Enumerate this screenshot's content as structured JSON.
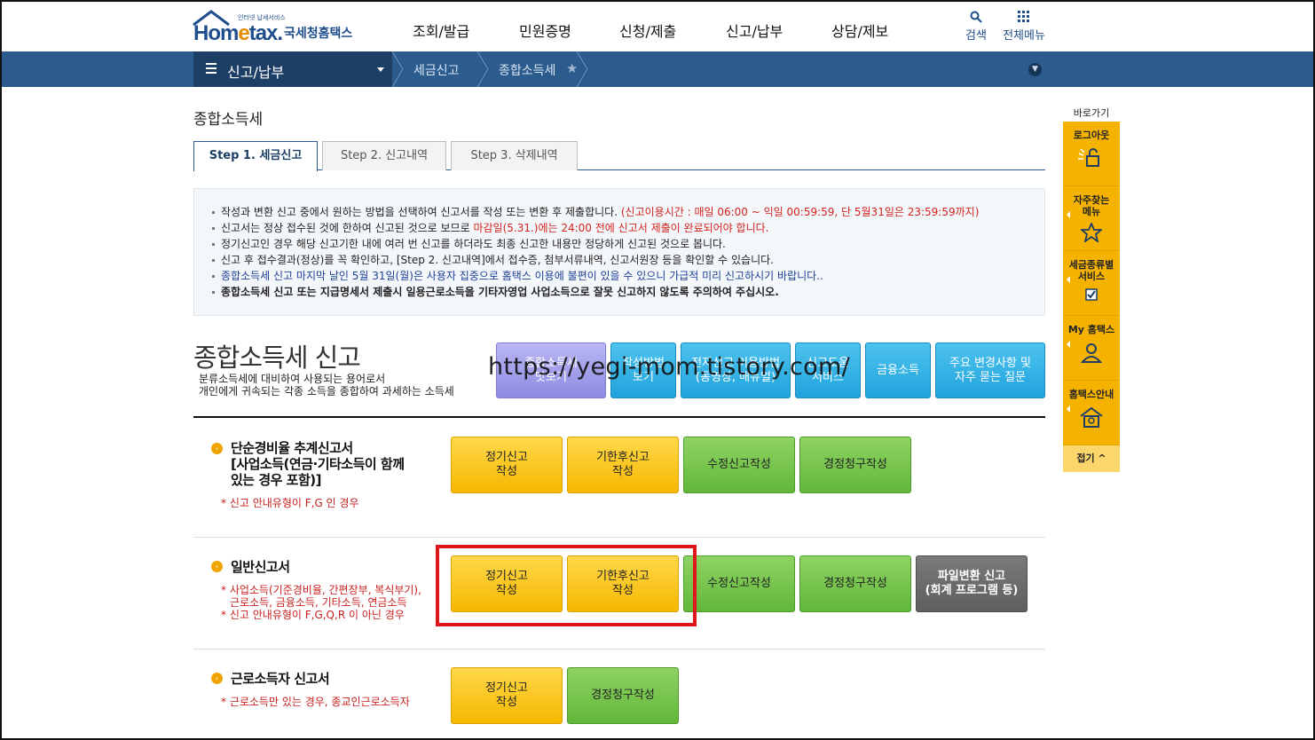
{
  "header": {
    "logo_sub": "인터넷 납세서비스",
    "logo_main": "Hometax",
    "logo_kr": "국세청홈택스",
    "gnb": [
      "조회/발급",
      "민원증명",
      "신청/제출",
      "신고/납부",
      "상담/제보"
    ],
    "search_label": "검색",
    "allmenu_label": "전체메뉴"
  },
  "nav": {
    "current": "신고/납부",
    "breadcrumbs": [
      "세금신고",
      "종합소득세"
    ]
  },
  "page": {
    "title": "종합소득세",
    "tabs": [
      {
        "label": "Step 1. 세금신고",
        "active": true
      },
      {
        "label": "Step 2. 신고내역",
        "active": false
      },
      {
        "label": "Step 3. 삭제내역",
        "active": false
      }
    ]
  },
  "notice": {
    "l1a": "작성과 변환 신고 중에서 원하는 방법을 선택하여 신고서를 작성 또는 변환 후 제출합니다.",
    "l1b": "(신고이용시간 : 매일 06:00 ~ 익일 00:59:59, 단 5월31일은 23:59:59까지)",
    "l2a": "신고서는 정상 접수된 것에 한하여 신고된 것으로 보므로 ",
    "l2b": "마감일(5.31.)에는 24:00 전에 신고서 제출이 완료되어야 합니다.",
    "l3": "정기신고인 경우 해당 신고기한 내에 여러 번 신고를 하더라도 최종 신고한 내용만 정당하게 신고된 것으로 봅니다.",
    "l4": "신고 후 접수결과(정상)를 꼭 확인하고, [Step 2. 신고내역]에서 접수증, 첨부서류내역, 신고서원장 등을 확인할 수 있습니다.",
    "l5": "종합소득세 신고 마지막 날인 5월 31일(월)은 사용자 집중으로 홈택스 이용에 불편이 있을 수 있으니 가급적 미리 신고하시기 바랍니다..",
    "l6": "종합소득세 신고 또는 지급명세서 제출시 일용근로소득을 기타자영업 사업소득으로 잘못 신고하지 않도록 주의하여 주십시오."
  },
  "section": {
    "title": "종합소득세 신고",
    "desc1": "분류소득세에 대비하여 사용되는 용어로서",
    "desc2": "개인에게 귀속되는 각종 소득을 종합하여 과세하는 소득세",
    "top_buttons": [
      {
        "label1": "종합소득세",
        "label2": "맛보기"
      },
      {
        "label1": "작성방법",
        "label2": "보기"
      },
      {
        "label1": "전자신고 이용방법",
        "label2": "(동영상, 매뉴얼)"
      },
      {
        "label1": "신고도움",
        "label2": "서비스"
      },
      {
        "label1": "금융소득",
        "label2": ""
      },
      {
        "label1": "주요 변경사항 및",
        "label2": "자주 묻는 질문"
      }
    ]
  },
  "rows": {
    "simple": {
      "title1": "단순경비율 추계신고서",
      "title2": "[사업소득(연금·기타소득이 함께",
      "title3": "있는 경우 포함)]",
      "note": "* 신고 안내유형이 F,G 인 경우",
      "btn_regular": [
        "정기신고",
        "작성"
      ],
      "btn_late": [
        "기한후신고",
        "작성"
      ],
      "btn_amend": "수정신고작성",
      "btn_claim": "경정청구작성"
    },
    "general": {
      "title": "일반신고서",
      "note1": "* 사업소득(기준경비율, 간편장부, 복식부기),",
      "note2": "근로소득, 금융소득, 기타소득, 연금소득",
      "note3": "* 신고 안내유형이 F,G,Q,R 이 아닌 경우",
      "btn_regular": [
        "정기신고",
        "작성"
      ],
      "btn_late": [
        "기한후신고",
        "작성"
      ],
      "btn_amend": "수정신고작성",
      "btn_claim": "경정청구작성",
      "btn_file": [
        "파일변환 신고",
        "(회계 프로그램 등)"
      ]
    },
    "worker": {
      "title": "근로소득자 신고서",
      "note": "* 근로소득만 있는 경우, 종교인근로소득자",
      "btn_regular": [
        "정기신고",
        "작성"
      ],
      "btn_claim": "경정청구작성"
    }
  },
  "watermark": "https://yegi-mom.tistory.com/",
  "quick": {
    "head": "바로가기",
    "items": [
      "로그아웃",
      "자주찾는|메뉴",
      "세금종류별|서비스",
      "My 홈택스",
      "홈택스안내"
    ],
    "fold": "접기 ^"
  },
  "colors": {
    "nav_blue": "#2c5b8e",
    "nav_dark": "#1d3f66",
    "yellow": "#f5b800",
    "green": "#62b73a",
    "sky": "#20a3dc",
    "highlight": "#e0161c"
  }
}
